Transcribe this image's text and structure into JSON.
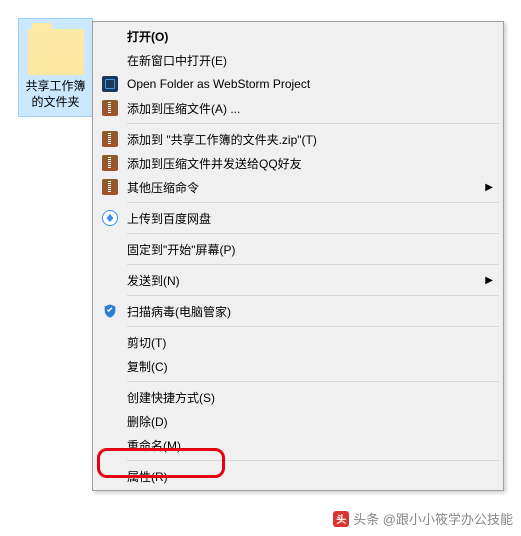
{
  "folder": {
    "name": "共享工作簿的文件夹"
  },
  "menu": {
    "items": [
      {
        "label": "打开(O)",
        "bold": true
      },
      {
        "label": "在新窗口中打开(E)"
      },
      {
        "label": "Open Folder as WebStorm Project",
        "icon": "webstorm"
      },
      {
        "label": "添加到压缩文件(A) ...",
        "icon": "zip"
      },
      {
        "sep": true
      },
      {
        "label": "添加到 \"共享工作簿的文件夹.zip\"(T)",
        "icon": "zip"
      },
      {
        "label": "添加到压缩文件并发送给QQ好友",
        "icon": "zip"
      },
      {
        "label": "其他压缩命令",
        "icon": "zip",
        "submenu": true
      },
      {
        "sep": true
      },
      {
        "label": "上传到百度网盘",
        "icon": "baidu"
      },
      {
        "sep": true
      },
      {
        "label": "固定到\"开始\"屏幕(P)"
      },
      {
        "sep": true
      },
      {
        "label": "发送到(N)",
        "submenu": true
      },
      {
        "sep": true
      },
      {
        "label": "扫描病毒(电脑管家)",
        "icon": "shield"
      },
      {
        "sep": true
      },
      {
        "label": "剪切(T)"
      },
      {
        "label": "复制(C)"
      },
      {
        "sep": true
      },
      {
        "label": "创建快捷方式(S)"
      },
      {
        "label": "删除(D)"
      },
      {
        "label": "重命名(M)"
      },
      {
        "sep": true
      },
      {
        "label": "属性(R)"
      }
    ]
  },
  "watermark": "头条 @跟小小筱学办公技能"
}
